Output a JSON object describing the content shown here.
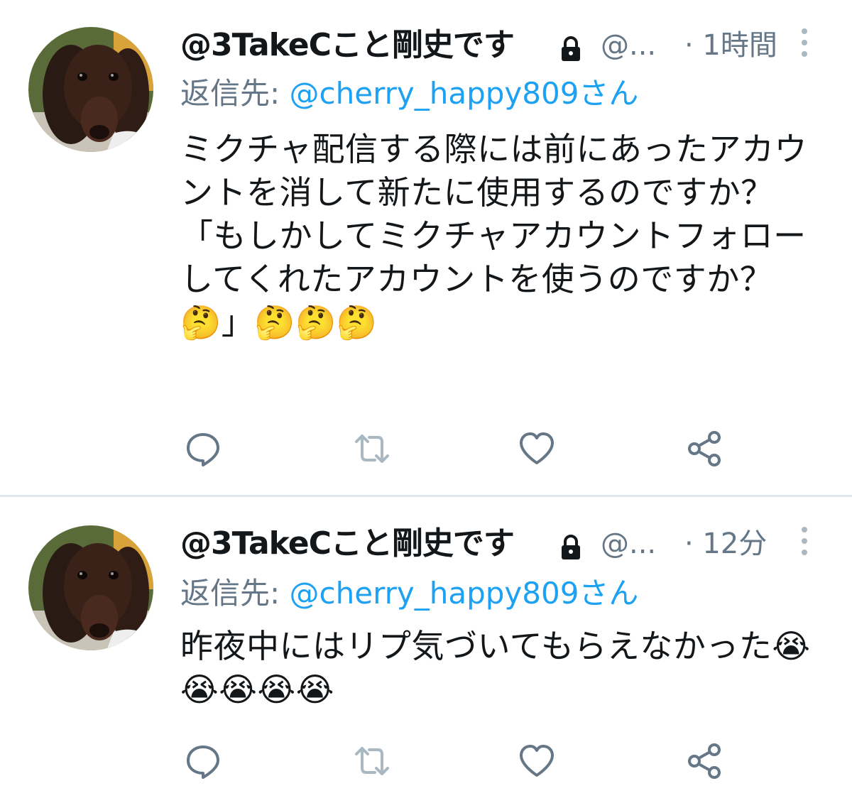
{
  "tweets": [
    {
      "display_name": "@3TakeCこと剛史です",
      "handle": "@...",
      "time": "· 1時間",
      "reply_prefix": "返信先: ",
      "reply_to": "@cherry_happy809さん",
      "text": "ミクチャ配信する際には前にあったアカウントを消して新たに使用するのですか？\n「もしかしてミクチャアカウントフォローしてくれたアカウントを使うのですか？🤔」🤔🤔🤔",
      "icons": {
        "avatar": "dog-avatar",
        "lock": "lock-icon",
        "more": "more-vertical-icon",
        "reply": "reply-icon",
        "retweet": "retweet-icon",
        "like": "heart-icon",
        "share": "share-icon"
      }
    },
    {
      "display_name": "@3TakeCこと剛史です",
      "handle": "@...",
      "time": "· 12分",
      "reply_prefix": "返信先: ",
      "reply_to": "@cherry_happy809さん",
      "text": "昨夜中にはリプ気づいてもらえなかった😭😭😭😭😭",
      "icons": {
        "avatar": "dog-avatar",
        "lock": "lock-icon",
        "more": "more-vertical-icon",
        "reply": "reply-icon",
        "retweet": "retweet-icon",
        "like": "heart-icon",
        "share": "share-icon"
      }
    }
  ],
  "colors": {
    "text_primary": "#14171a",
    "text_secondary": "#657786",
    "link": "#1da1f2",
    "icon": "#657786",
    "retweet_disabled": "#aab8c2",
    "divider": "#e1e8ed"
  }
}
